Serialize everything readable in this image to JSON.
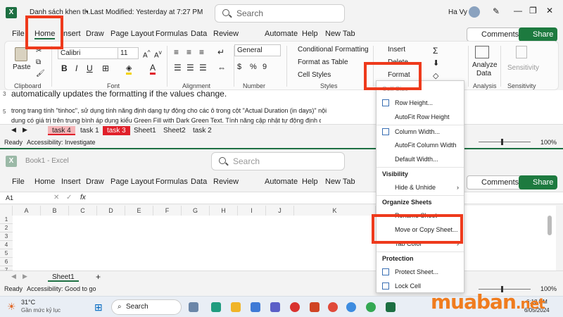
{
  "top_window": {
    "title": "Danh sách khen th...",
    "modified": "• Last Modified: Yesterday at 7:27 PM",
    "search_placeholder": "Search",
    "user": "Ha Vy",
    "menus": [
      "File",
      "Home",
      "Insert",
      "Draw",
      "Page Layout",
      "Formulas",
      "Data",
      "Review",
      "Automate",
      "Help",
      "New Tab"
    ],
    "comments_label": "Comments",
    "share_label": "Share",
    "ribbon": {
      "paste_label": "Paste",
      "clipboard_label": "Clipboard",
      "font_name": "Calibri",
      "font_size": "11",
      "font_label": "Font",
      "alignment_label": "Alignment",
      "number_format": "General",
      "number_label": "Number",
      "cond_format": "Conditional Formatting",
      "format_table": "Format as Table",
      "cell_styles": "Cell Styles",
      "styles_label": "Styles",
      "insert_label": "Insert",
      "delete_label": "Delete",
      "format_label": "Format",
      "analyze_line1": "Analyze",
      "analyze_line2": "Data",
      "analysis_label": "Analysis",
      "sensitivity_label": "Sensitivity",
      "sensitivity_group": "Sensitivity"
    },
    "sheet_lines": {
      "row3": "automatically updates the formatting if the values change.",
      "row5a": "trong trang tính \"tinhoc\", sử dụng tính năng định dạng tự động cho các ô trong cột \"Actual Duration (in days)\" nội",
      "row5b": "dung có giá trị trên trung bình áp dụng kiểu Green Fill with Dark Green Text. Tính năng cập nhật tự động định dạng"
    },
    "row_numbers": [
      "3",
      "5"
    ],
    "tabs": [
      "task 4",
      "task 1",
      "task 3",
      "Sheet1",
      "Sheet2",
      "task 2"
    ],
    "status": "Accessibility: Investigate",
    "zoom": "100%"
  },
  "bottom_window": {
    "title": "Book1 - Excel",
    "search_placeholder": "Search",
    "menus": [
      "File",
      "Home",
      "Insert",
      "Draw",
      "Page Layout",
      "Formulas",
      "Data",
      "Review",
      "Automate",
      "Help",
      "New Tab"
    ],
    "comments_label": "Comments",
    "share_label": "Share",
    "name_box": "A1",
    "fx": "fx",
    "columns": [
      "A",
      "B",
      "C",
      "D",
      "E",
      "F",
      "G",
      "H",
      "I",
      "J",
      "K"
    ],
    "rows": [
      "1",
      "2",
      "3",
      "4",
      "5",
      "6",
      "7"
    ],
    "tab": "Sheet1",
    "status": "Accessibility: Good to go",
    "zoom": "100%"
  },
  "format_menu": {
    "cell_size_head": "Cell Size",
    "row_height": "Row Height...",
    "autofit_row": "AutoFit Row Height",
    "col_width": "Column Width...",
    "autofit_col": "AutoFit Column Width",
    "default_width": "Default Width...",
    "visibility_head": "Visibility",
    "hide_unhide": "Hide & Unhide",
    "organize_head": "Organize Sheets",
    "rename_sheet": "Rename Sheet",
    "move_copy": "Move or Copy Sheet...",
    "tab_color": "Tab Color",
    "protection_head": "Protection",
    "protect_sheet": "Protect Sheet...",
    "lock_cell": "Lock Cell"
  },
  "taskbar": {
    "temperature": "31°C",
    "weather": "Gần mức kỷ lục",
    "search": "Search",
    "time": "6:18 PM",
    "date": "6/05/2024"
  },
  "watermark": {
    "text1": "muaban",
    "text2": ".net"
  },
  "colors": {
    "excel_green": "#1d6f42",
    "highlight": "#ee3a1c",
    "tab_red": "#e0202a"
  }
}
